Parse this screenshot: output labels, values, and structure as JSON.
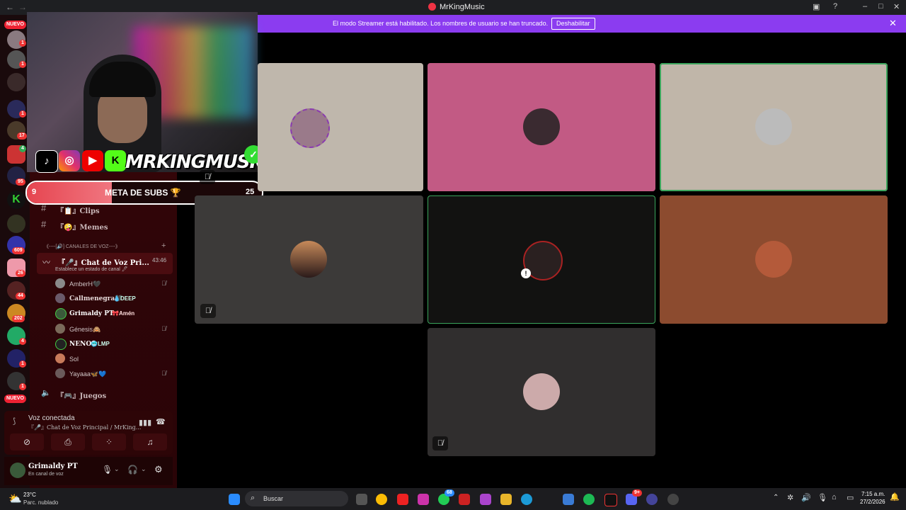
{
  "window": {
    "title": "MrKingMusic",
    "back_icon": "arrow-left-icon"
  },
  "streamer_banner": {
    "message": "El modo Streamer está habilitado. Los nombres de usuario se han truncado.",
    "button": "Deshabilitar"
  },
  "server_rail": {
    "nuevo_top": "NUEVO",
    "nuevo_bottom": "NUEVO",
    "badges": [
      "1",
      "1",
      "1",
      "17",
      "4",
      "95",
      "609",
      "26",
      "44",
      "202",
      "4",
      "1",
      "1"
    ]
  },
  "overlay": {
    "brand": "MRKINGMUSIC",
    "goal_label": "META DE SUBS 🏆",
    "goal_current": "9",
    "goal_target": "25",
    "goal_progress": 0.36
  },
  "channels": {
    "text": [
      {
        "label": "『📋』Clips"
      },
      {
        "label": "『🤪』Memes"
      }
    ],
    "voice_category": "《----[🔊] CANALES DE VOZ----》",
    "active_voice": {
      "label": "『🎤』Chat de Voz Pri...",
      "timer": "43:46",
      "status": "Establece un estado de canal 🖊"
    },
    "members": [
      {
        "name": "AmberH🖤",
        "tag": "",
        "muted": true,
        "color": "#cfc3c4",
        "bold": false
      },
      {
        "name": "Callmenegra🖤",
        "tag": "💧DEEP",
        "muted": false,
        "color": "#e8dcdc",
        "bold": true
      },
      {
        "name": "Grimaldy PT",
        "tag": "🎀Amén",
        "muted": false,
        "color": "#ffffff",
        "bold": true
      },
      {
        "name": "Génesis🙈",
        "tag": "",
        "muted": true,
        "color": "#cfc3c4",
        "bold": false
      },
      {
        "name": "NENO",
        "tag": "🥶LMP",
        "muted": false,
        "color": "#ffffff",
        "bold": true
      },
      {
        "name": "Sol",
        "tag": "",
        "muted": false,
        "color": "#cfc3c4",
        "bold": false
      },
      {
        "name": "Yayaaa🦋💙",
        "tag": "",
        "muted": true,
        "color": "#cfc3c4",
        "bold": false
      }
    ],
    "next_voice": "『🎮』Juegos"
  },
  "voice_panel": {
    "status": "Voz conectada",
    "channel": "『🎤』Chat de Voz Principal / MrKing..."
  },
  "user_panel": {
    "name": "Grimaldy PT",
    "status": "En canal de voz"
  },
  "taskbar": {
    "weather_temp": "23°C",
    "weather_desc": "Parc. nublado",
    "search": "Buscar",
    "time": "7:15 a.m.",
    "date": "27/2/2026",
    "whatsapp_badge": "68",
    "discord_badge": "9+"
  }
}
